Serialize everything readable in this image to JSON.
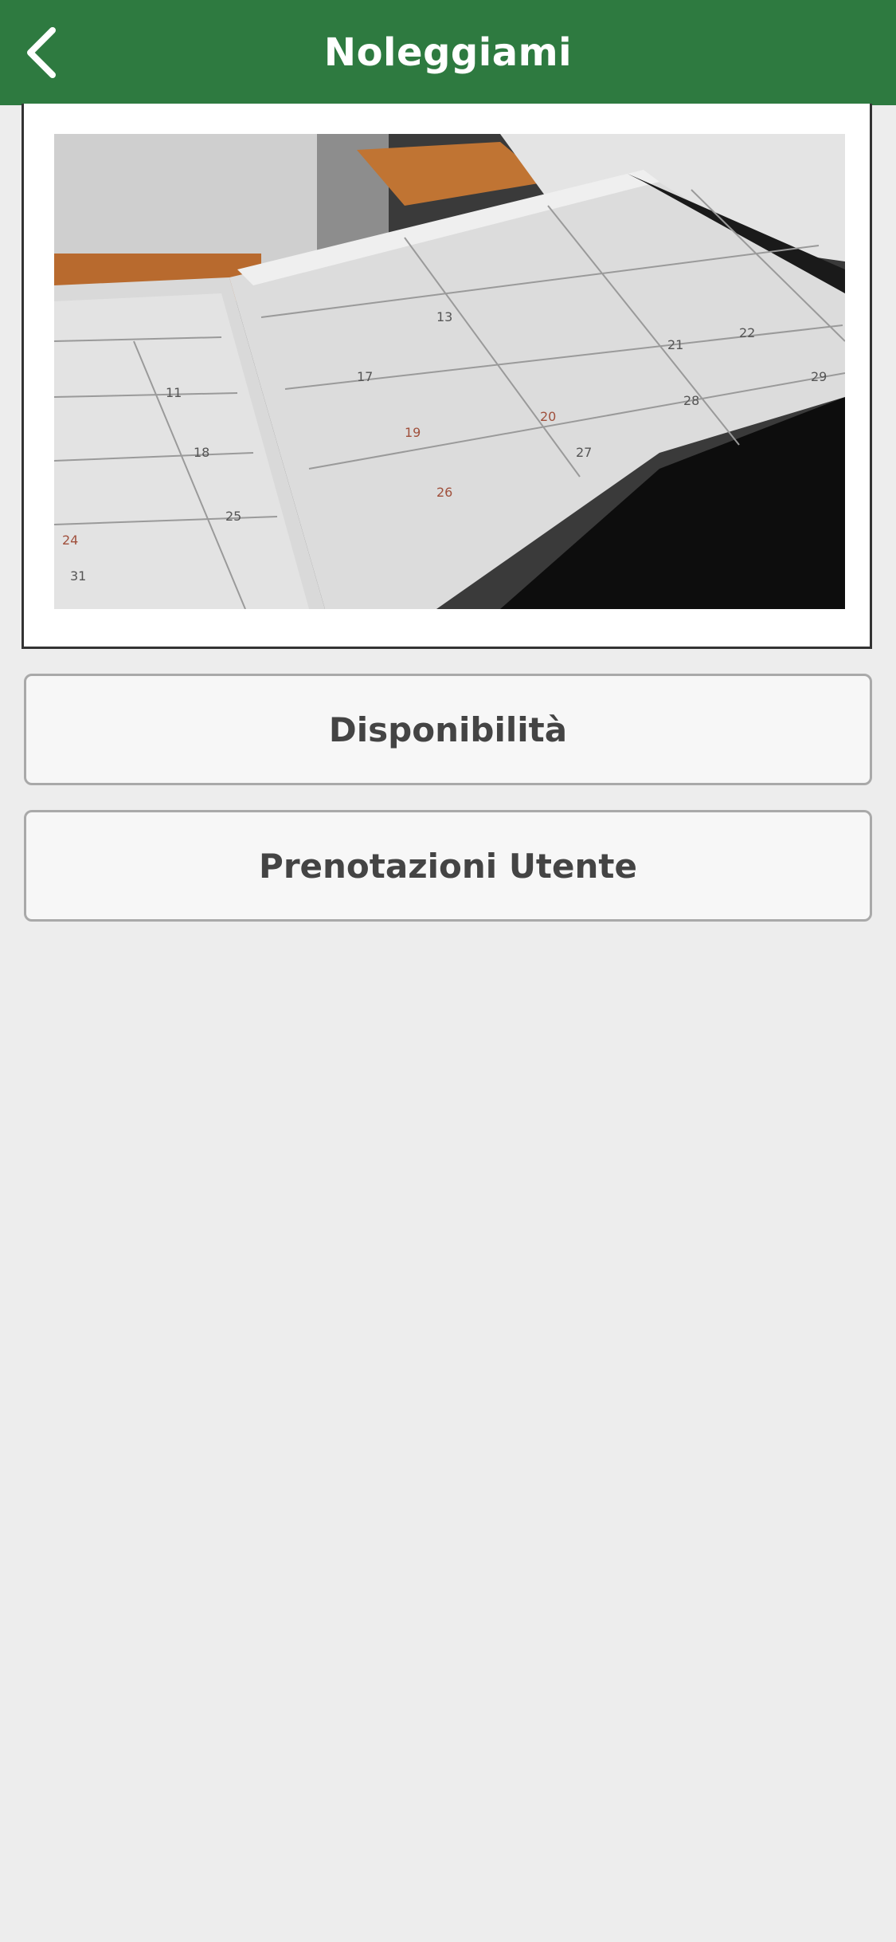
{
  "header": {
    "title": "Noleggiami",
    "back_icon": "chevron-left-icon",
    "background_color": "#2e7a40"
  },
  "hero_image": {
    "subject": "open-planner-calendar",
    "visible_dates": [
      "11",
      "18",
      "25",
      "13",
      "20",
      "27",
      "21",
      "28",
      "22",
      "29",
      "19",
      "26",
      "24",
      "31",
      "17"
    ]
  },
  "menu": {
    "disponibilita_label": "Disponibilità",
    "prenotazioni_label": "Prenotazioni Utente"
  }
}
